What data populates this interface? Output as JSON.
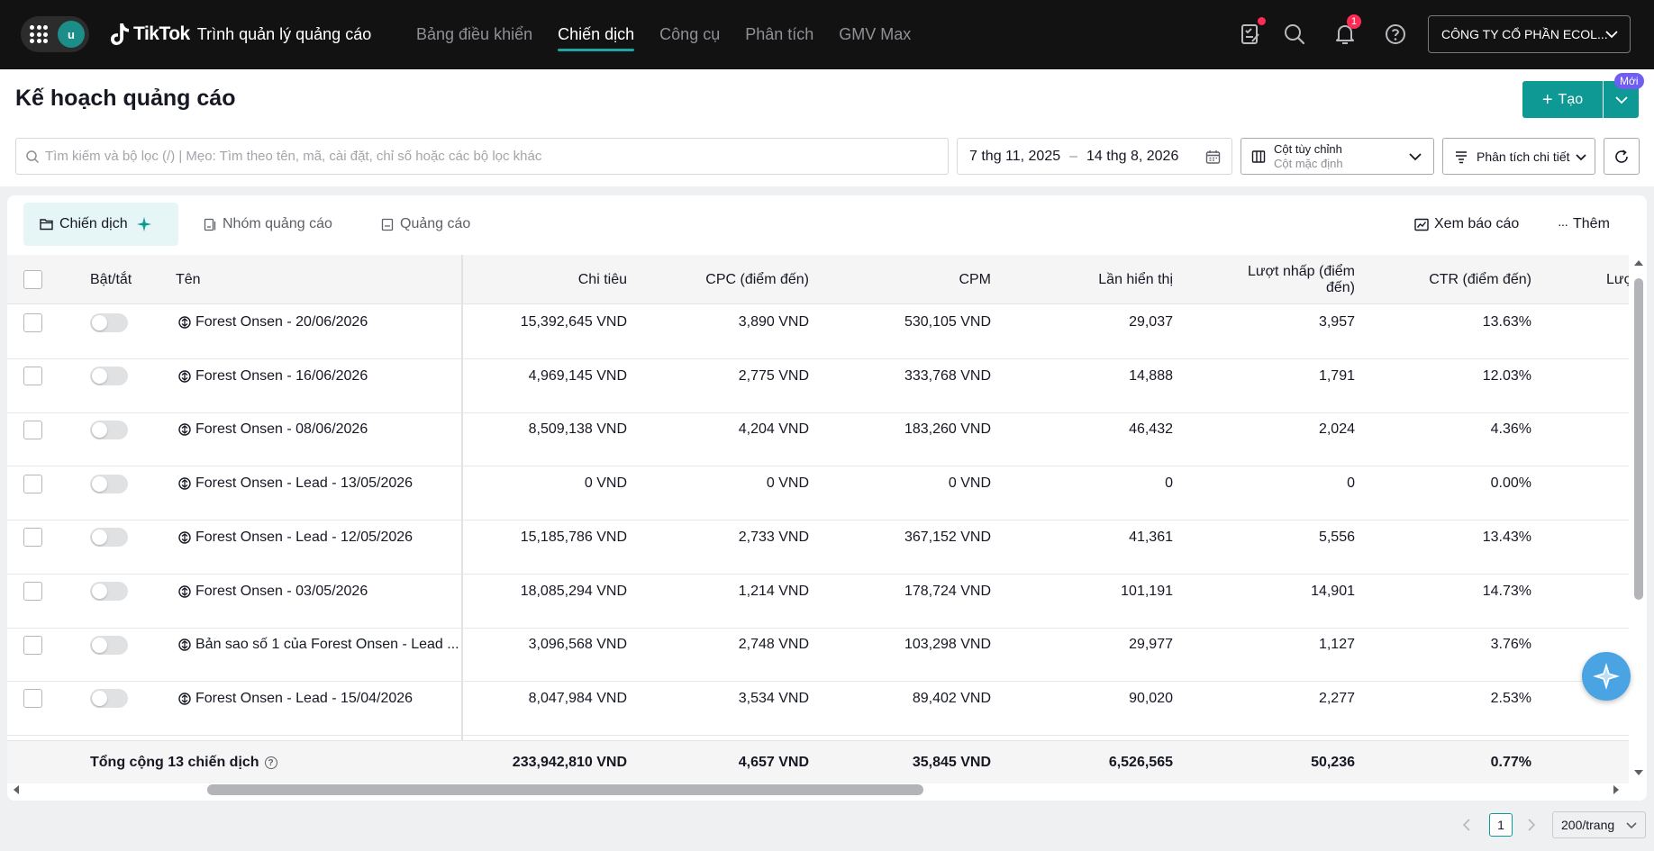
{
  "topbar": {
    "avatar_letter": "u",
    "brand_name": "TikTok",
    "brand_sub": "Trình quản lý quảng cáo",
    "nav": [
      {
        "label": "Bảng điều khiển",
        "active": false
      },
      {
        "label": "Chiến dịch",
        "active": true
      },
      {
        "label": "Công cụ",
        "active": false
      },
      {
        "label": "Phân tích",
        "active": false
      },
      {
        "label": "GMV Max",
        "active": false
      }
    ],
    "notification_count": "1",
    "account_name": "CÔNG TY CỔ PHẦN ECOL..."
  },
  "header": {
    "title": "Kế hoạch quảng cáo",
    "create_label": "Tạo",
    "new_badge": "Mới",
    "search_placeholder": "Tìm kiếm và bộ lọc (/) | Mẹo: Tìm theo tên, mã, cài đặt, chỉ số hoặc các bộ lọc khác",
    "date_start": "7 thg 11, 2025",
    "date_sep": "–",
    "date_end": "14 thg 8, 2026",
    "columns_label": "Cột tùy chỉnh",
    "columns_value": "Cột mặc định",
    "analysis_label": "Phân tích chi tiết"
  },
  "tabs": {
    "campaign": "Chiến dịch",
    "adgroup": "Nhóm quảng cáo",
    "ad": "Quảng cáo",
    "view_report": "Xem báo cáo",
    "more": "Thêm"
  },
  "table": {
    "headers": {
      "toggle": "Bật/tắt",
      "name": "Tên",
      "spend": "Chi tiêu",
      "cpc": "CPC (điểm đến)",
      "cpm": "CPM",
      "impressions": "Lần hiển thị",
      "clicks_l1": "Lượt nhấp (điểm",
      "clicks_l2": "đến)",
      "ctr": "CTR (điểm đến)",
      "next": "Lượ"
    },
    "rows": [
      {
        "name": "Forest Onsen - 20/06/2026",
        "spend": "15,392,645 VND",
        "cpc": "3,890 VND",
        "cpm": "530,105 VND",
        "impressions": "29,037",
        "clicks": "3,957",
        "ctr": "13.63%"
      },
      {
        "name": "Forest Onsen - 16/06/2026",
        "spend": "4,969,145 VND",
        "cpc": "2,775 VND",
        "cpm": "333,768 VND",
        "impressions": "14,888",
        "clicks": "1,791",
        "ctr": "12.03%"
      },
      {
        "name": "Forest Onsen - 08/06/2026",
        "spend": "8,509,138 VND",
        "cpc": "4,204 VND",
        "cpm": "183,260 VND",
        "impressions": "46,432",
        "clicks": "2,024",
        "ctr": "4.36%"
      },
      {
        "name": "Forest Onsen - Lead - 13/05/2026",
        "spend": "0 VND",
        "cpc": "0 VND",
        "cpm": "0 VND",
        "impressions": "0",
        "clicks": "0",
        "ctr": "0.00%"
      },
      {
        "name": "Forest Onsen - Lead - 12/05/2026",
        "spend": "15,185,786 VND",
        "cpc": "2,733 VND",
        "cpm": "367,152 VND",
        "impressions": "41,361",
        "clicks": "5,556",
        "ctr": "13.43%"
      },
      {
        "name": "Forest Onsen - 03/05/2026",
        "spend": "18,085,294 VND",
        "cpc": "1,214 VND",
        "cpm": "178,724 VND",
        "impressions": "101,191",
        "clicks": "14,901",
        "ctr": "14.73%"
      },
      {
        "name": "Bản sao số 1 của Forest Onsen - Lead ...",
        "spend": "3,096,568 VND",
        "cpc": "2,748 VND",
        "cpm": "103,298 VND",
        "impressions": "29,977",
        "clicks": "1,127",
        "ctr": "3.76%"
      },
      {
        "name": "Forest Onsen - Lead - 15/04/2026",
        "spend": "8,047,984 VND",
        "cpc": "3,534 VND",
        "cpm": "89,402 VND",
        "impressions": "90,020",
        "clicks": "2,277",
        "ctr": "2.53%"
      }
    ],
    "total": {
      "label": "Tổng cộng 13 chiến dịch",
      "help": "?",
      "spend": "233,942,810 VND",
      "cpc": "4,657 VND",
      "cpm": "35,845 VND",
      "impressions": "6,526,565",
      "clicks": "50,236",
      "ctr": "0.77%"
    }
  },
  "pagination": {
    "current_page": "1",
    "page_size": "200/trang"
  },
  "colors": {
    "accent": "#0e9995",
    "topbar": "#121212",
    "badge": "#fe2c55",
    "new_badge": "#6f5ef1"
  }
}
